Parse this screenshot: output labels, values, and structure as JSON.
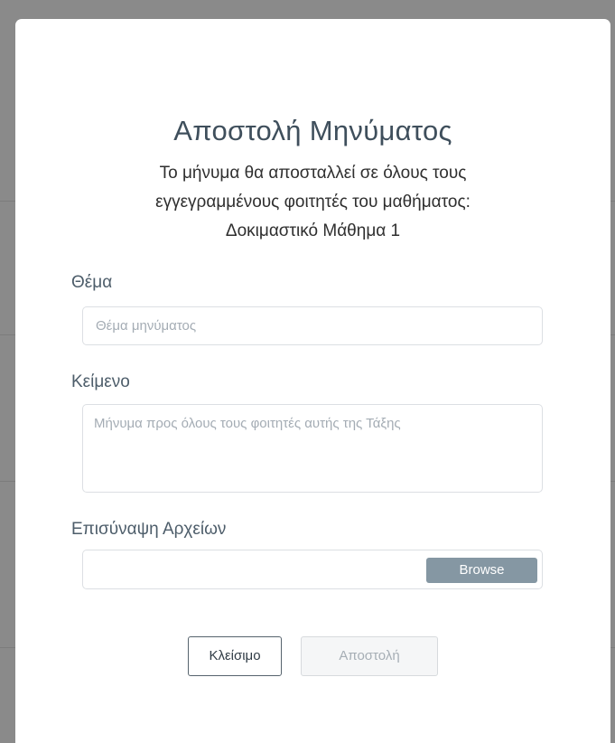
{
  "modal": {
    "title": "Αποστολή Μηνύματος",
    "description_line1": "Το μήνυμα θα αποσταλλεί σε όλους τους",
    "description_line2": "εγγεγραμμένους φοιτητές του μαθήματος:",
    "course_name": "Δοκιμαστικό Μάθημα 1"
  },
  "subject": {
    "label": "Θέμα",
    "placeholder": "Θέμα μηνύματος",
    "value": ""
  },
  "body": {
    "label": "Κείμενο",
    "placeholder": "Μήνυμα προς όλους τους φοιτητές αυτής της Τάξης",
    "value": ""
  },
  "attachments": {
    "label": "Επισύναψη Αρχείων",
    "file_name": "",
    "browse_label": "Browse"
  },
  "actions": {
    "close_label": "Κλείσιμο",
    "send_label": "Αποστολή"
  },
  "colors": {
    "title": "#3f4f5c",
    "browse_button": "#8597a3",
    "backdrop": "#8a8a8a"
  }
}
